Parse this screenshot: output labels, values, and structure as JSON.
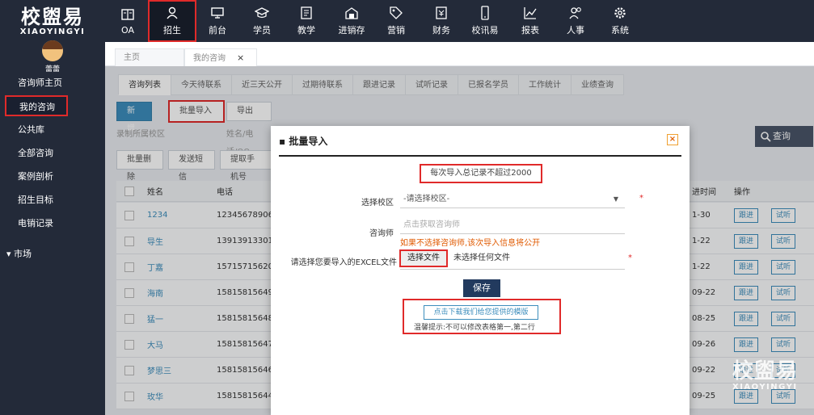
{
  "brand": {
    "name_cn": "校盥易",
    "name_en": "XIAOYINGYI"
  },
  "topnav": [
    {
      "label": "OA",
      "icon": "card-icon"
    },
    {
      "label": "招生",
      "icon": "user-icon",
      "active": true
    },
    {
      "label": "前台",
      "icon": "monitor-icon"
    },
    {
      "label": "学员",
      "icon": "graduation-cap-icon"
    },
    {
      "label": "教学",
      "icon": "book-icon"
    },
    {
      "label": "进销存",
      "icon": "warehouse-icon"
    },
    {
      "label": "营销",
      "icon": "tag-icon"
    },
    {
      "label": "财务",
      "icon": "wallet-icon"
    },
    {
      "label": "校讯易",
      "icon": "phone-icon"
    },
    {
      "label": "报表",
      "icon": "chart-icon"
    },
    {
      "label": "人事",
      "icon": "people-icon"
    },
    {
      "label": "系统",
      "icon": "gear-icon"
    }
  ],
  "user": {
    "name": "蕾蕾"
  },
  "sidebar": {
    "items": [
      {
        "label": "咨询师主页"
      },
      {
        "label": "我的咨询",
        "active": true
      },
      {
        "label": "公共库"
      },
      {
        "label": "全部咨询"
      },
      {
        "label": "案例剖析"
      },
      {
        "label": "招生目标"
      },
      {
        "label": "电销记录"
      }
    ],
    "group": "市场"
  },
  "page_tabs": [
    {
      "label": "主页"
    },
    {
      "label": "我的咨询",
      "close": "×"
    }
  ],
  "sub_tabs": [
    "咨询列表",
    "今天待联系",
    "近三天公开",
    "过期待联系",
    "跟进记录",
    "试听记录",
    "已报名学员",
    "工作统计",
    "业绩查询"
  ],
  "toolbar": {
    "add": "新增",
    "batch_import": "批量导入",
    "export": "导出"
  },
  "filters": {
    "campus": "录制所属校区",
    "name_hint": "姓名/电话/QQ"
  },
  "actions": {
    "batch_delete": "批量删除",
    "send_sms": "发送短信",
    "extract_phone": "提取手机号"
  },
  "search_label": "查询",
  "table": {
    "headers": {
      "name": "姓名",
      "phone": "电话",
      "time": "进时间",
      "ops": "操作"
    },
    "rows": [
      {
        "name": "1234",
        "phone": "12345678906",
        "date": "1-30"
      },
      {
        "name": "导生",
        "phone": "13913913301",
        "date": "1-22"
      },
      {
        "name": "丁嘉",
        "phone": "15715715620",
        "date": "1-22"
      },
      {
        "name": "海南",
        "phone": "15815815649",
        "date": "09-22"
      },
      {
        "name": "猛一",
        "phone": "15815815648",
        "date": "08-25"
      },
      {
        "name": "大马",
        "phone": "15815815647",
        "date": "09-26"
      },
      {
        "name": "梦思三",
        "phone": "15815815646",
        "date": "09-22"
      },
      {
        "name": "玫华",
        "phone": "15815815644",
        "date": "09-25"
      }
    ],
    "btn_follow": "跟进",
    "btn_trial": "试听"
  },
  "modal": {
    "title": "批量导入",
    "close": "×",
    "limit_note": "每次导入总记录不超过2000",
    "campus_label": "选择校区",
    "campus_value": "-请选择校区-",
    "consultant_label": "咨询师",
    "consultant_placeholder": "点击获取咨询师",
    "consultant_warning": "如果不选择咨询师,该次导入信息将公开",
    "file_label": "请选择您要导入的EXCEL文件",
    "file_button": "选择文件",
    "file_status": "未选择任何文件",
    "save": "保存",
    "template_button": "点击下载我们给您提供的模版",
    "template_tip": "温馨提示:不可以修改表格第一,第二行",
    "required_mark": "*"
  },
  "watermark": {
    "cn": "校盥易",
    "en": "XIAOYINGYI"
  }
}
